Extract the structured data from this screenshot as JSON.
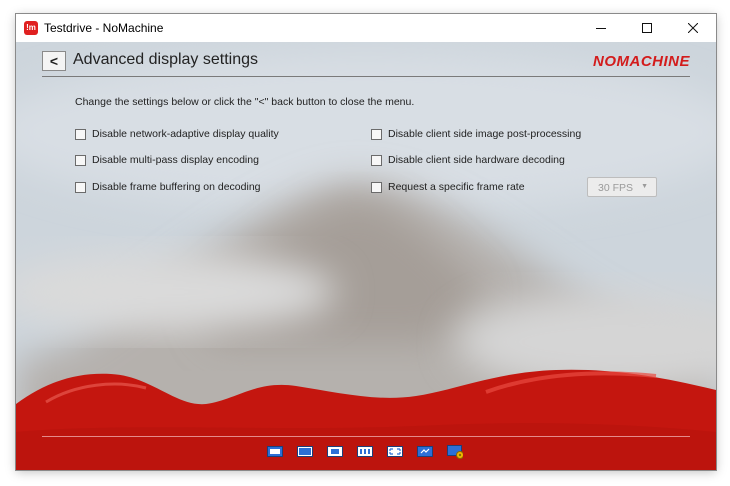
{
  "window": {
    "title": "Testdrive - NoMachine",
    "app_icon_text": "!m"
  },
  "header": {
    "back_label": "<",
    "title": "Advanced display settings",
    "brand": "NOMACHINE"
  },
  "instructions": "Change the settings below or click the \"<\" back button to close the menu.",
  "options_left": [
    {
      "label": "Disable network-adaptive display quality",
      "checked": false
    },
    {
      "label": "Disable multi-pass display encoding",
      "checked": false
    },
    {
      "label": "Disable frame buffering on decoding",
      "checked": false
    }
  ],
  "options_right": [
    {
      "label": "Disable client side image post-processing",
      "checked": false
    },
    {
      "label": "Disable client side hardware decoding",
      "checked": false
    },
    {
      "label": "Request a specific frame rate",
      "checked": false
    }
  ],
  "fps_select": {
    "value": "30 FPS",
    "enabled": false
  },
  "toolbar_icons": [
    "display-all-icon",
    "fit-to-window-icon",
    "scale-icon",
    "resize-icon",
    "fullscreen-icon",
    "display-settings-icon",
    "advanced-settings-icon"
  ],
  "colors": {
    "accent_red": "#c4160f",
    "brand_red": "#d31c1c"
  }
}
